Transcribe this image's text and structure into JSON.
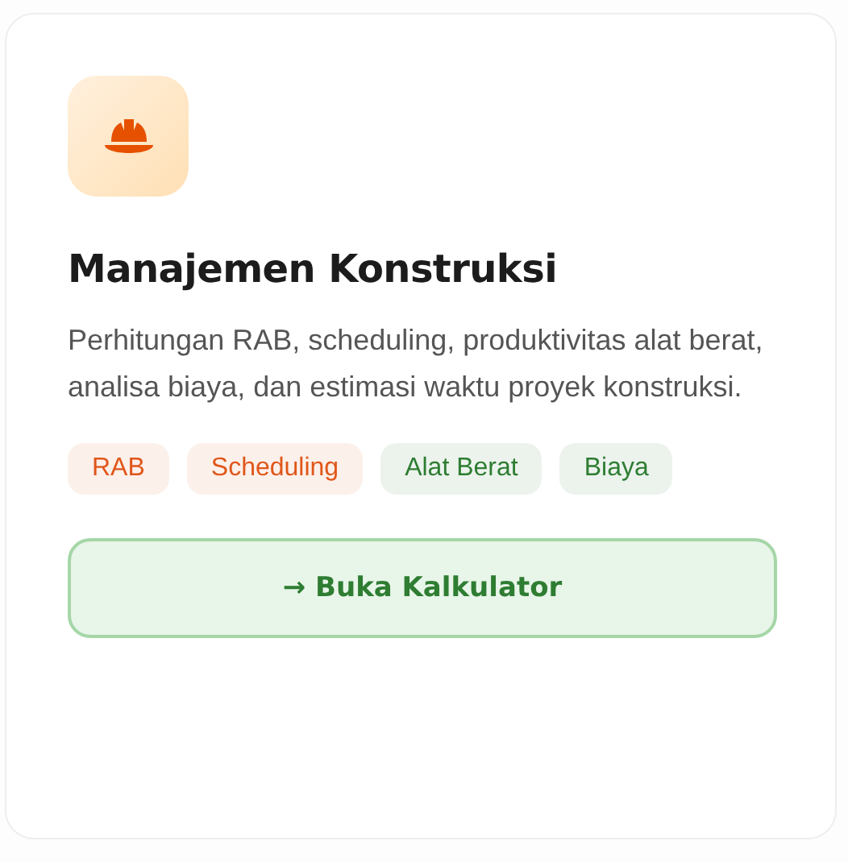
{
  "card": {
    "title": "Manajemen Konstruksi",
    "description": "Perhitungan RAB, scheduling, produktivitas alat berat, analisa biaya, dan estimasi waktu proyek konstruksi.",
    "tags": [
      {
        "label": "RAB",
        "color": "#e0571a"
      },
      {
        "label": "Scheduling",
        "color": "#e0571a"
      },
      {
        "label": "Alat Berat",
        "color": "#2e7d32"
      },
      {
        "label": "Biaya",
        "color": "#2e7d32"
      }
    ],
    "button": "→ Buka Kalkulator"
  }
}
